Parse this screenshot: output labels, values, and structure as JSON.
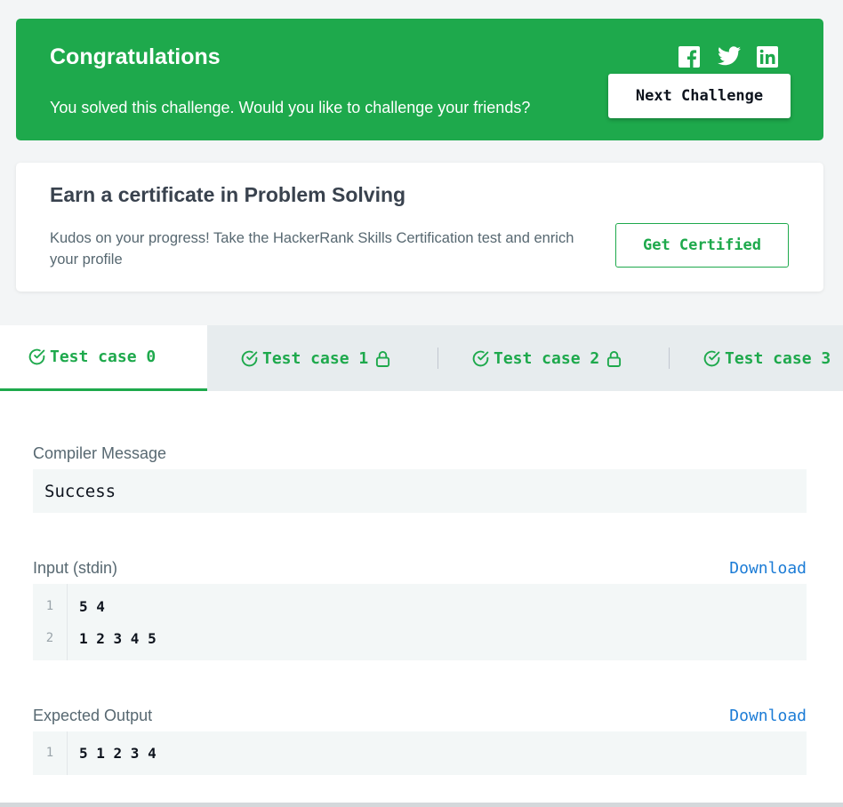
{
  "congrats": {
    "title": "Congratulations",
    "message": "You solved this challenge. Would you like to challenge your friends?",
    "next_button": "Next Challenge",
    "social_icons": [
      "facebook-icon",
      "twitter-icon",
      "linkedin-icon"
    ]
  },
  "certificate": {
    "title": "Earn a certificate in Problem Solving",
    "text": "Kudos on your progress! Take the HackerRank Skills Certification test and enrich your profile",
    "button": "Get Certified"
  },
  "tabs": [
    {
      "label": "Test case 0",
      "active": true,
      "locked": false
    },
    {
      "label": "Test case 1",
      "active": false,
      "locked": true
    },
    {
      "label": "Test case 2",
      "active": false,
      "locked": true
    },
    {
      "label": "Test case 3",
      "active": false,
      "locked": false
    }
  ],
  "compiler": {
    "label": "Compiler Message",
    "message": "Success"
  },
  "input": {
    "label": "Input (stdin)",
    "download": "Download",
    "lines": [
      {
        "num": "1",
        "text": "5 4"
      },
      {
        "num": "2",
        "text": "1 2 3 4 5"
      }
    ]
  },
  "expected": {
    "label": "Expected Output",
    "download": "Download",
    "lines": [
      {
        "num": "1",
        "text": "5 1 2 3 4"
      }
    ]
  },
  "colors": {
    "accent": "#1ea94c",
    "link": "#1c7cd6",
    "text": "#39424e",
    "background": "#f3f5f6"
  }
}
